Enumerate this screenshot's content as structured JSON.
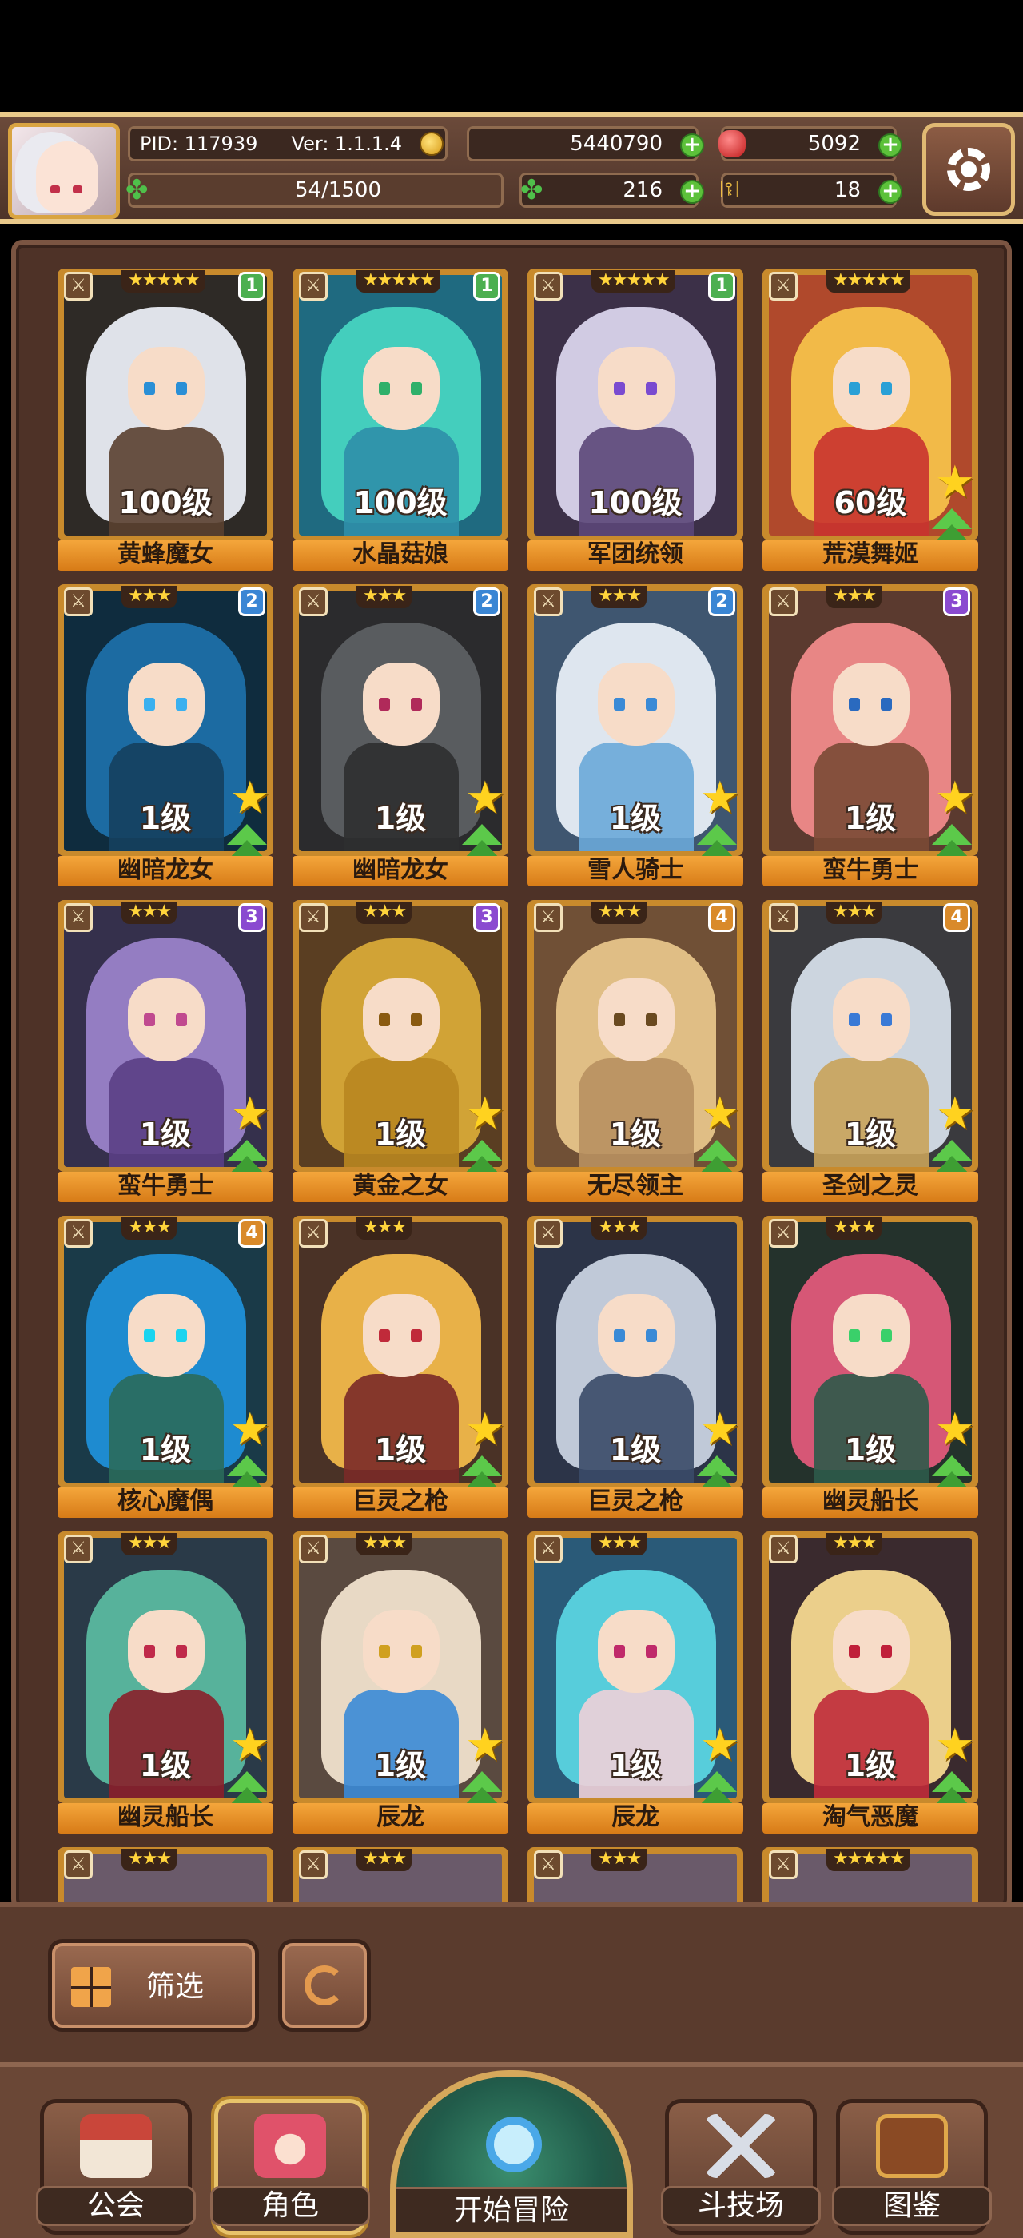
{
  "header": {
    "pid": "PID: 117939",
    "version": "Ver: 1.1.1.4",
    "gold": "5440790",
    "rubies": "5092",
    "energy": "54/1500",
    "clovers": "216",
    "keys": "18",
    "icons": {
      "gold": "coin-icon",
      "rubies": "ruby-icon",
      "energy": "clover-icon",
      "clovers": "clover-icon",
      "keys": "key-icon",
      "settings": "gear-icon"
    }
  },
  "characters": [
    {
      "name": "黄蜂魔女",
      "level": "100级",
      "stars": "★★★★★",
      "tier": "1",
      "tier_color": "#4caf50",
      "hair": "#e9ecf3",
      "body": "#5a4030",
      "bg": "#2e2a26",
      "eye": "#2a8fd6",
      "has_star": false
    },
    {
      "name": "水晶菇娘",
      "level": "100级",
      "stars": "★★★★★",
      "tier": "1",
      "tier_color": "#4caf50",
      "hair": "#47d4c0",
      "body": "#2f8fa8",
      "bg": "#1f6a80",
      "eye": "#2fb06a",
      "has_star": false
    },
    {
      "name": "军团统领",
      "level": "100级",
      "stars": "★★★★★",
      "tier": "1",
      "tier_color": "#4caf50",
      "hair": "#d9d4ec",
      "body": "#5b4778",
      "bg": "#3c3048",
      "eye": "#7a4bd0",
      "has_star": false
    },
    {
      "name": "荒漠舞姬",
      "level": "60级",
      "stars": "★★★★★",
      "tier": "",
      "tier_color": "",
      "hair": "#f6c14a",
      "body": "#c9332f",
      "bg": "#b0492c",
      "eye": "#2aa0d6",
      "has_star": true
    },
    {
      "name": "幽暗龙女",
      "level": "1级",
      "stars": "★★★",
      "tier": "2",
      "tier_color": "#3a86d4",
      "hair": "#1d6fa8",
      "body": "#15405e",
      "bg": "#0f2c3e",
      "eye": "#3ab0ef",
      "has_star": true
    },
    {
      "name": "幽暗龙女",
      "level": "1级",
      "stars": "★★★",
      "tier": "2",
      "tier_color": "#3a86d4",
      "hair": "#5c5f62",
      "body": "#2e2f30",
      "bg": "#2b2b2d",
      "eye": "#b02a5a",
      "has_star": true
    },
    {
      "name": "雪人骑士",
      "level": "1级",
      "stars": "★★★",
      "tier": "2",
      "tier_color": "#3a86d4",
      "hair": "#e7eef5",
      "body": "#6aa8d8",
      "bg": "#3f5670",
      "eye": "#3a8ad6",
      "has_star": true
    },
    {
      "name": "蛮牛勇士",
      "level": "1级",
      "stars": "★★★",
      "tier": "3",
      "tier_color": "#8a4ad0",
      "hair": "#f08a8a",
      "body": "#7a4a35",
      "bg": "#5b3a2f",
      "eye": "#2a6abf",
      "has_star": true
    },
    {
      "name": "蛮牛勇士",
      "level": "1级",
      "stars": "★★★",
      "tier": "3",
      "tier_color": "#8a4ad0",
      "hair": "#9a82c8",
      "body": "#5a3f85",
      "bg": "#35304c",
      "eye": "#c04a8f",
      "has_star": true
    },
    {
      "name": "黄金之女",
      "level": "1级",
      "stars": "★★★",
      "tier": "3",
      "tier_color": "#8a4ad0",
      "hair": "#d8a938",
      "body": "#b88620",
      "bg": "#5a3e22",
      "eye": "#8a5a10",
      "has_star": true
    },
    {
      "name": "无尽领主",
      "level": "1级",
      "stars": "★★★",
      "tier": "4",
      "tier_color": "#d98a2a",
      "hair": "#e6c48a",
      "body": "#b89060",
      "bg": "#705036",
      "eye": "#6a4a20",
      "has_star": true
    },
    {
      "name": "圣剑之灵",
      "level": "1级",
      "stars": "★★★",
      "tier": "4",
      "tier_color": "#d98a2a",
      "hair": "#d4dde8",
      "body": "#c9a35a",
      "bg": "#3a3a3e",
      "eye": "#3a7ad6",
      "has_star": true
    },
    {
      "name": "核心魔偶",
      "level": "1级",
      "stars": "★★★",
      "tier": "4",
      "tier_color": "#d98a2a",
      "hair": "#1f8fd8",
      "body": "#2a6a5a",
      "bg": "#1a3a48",
      "eye": "#1ad4ef",
      "has_star": true
    },
    {
      "name": "巨灵之枪",
      "level": "1级",
      "stars": "★★★",
      "tier": "",
      "tier_color": "",
      "hair": "#f0b84a",
      "body": "#7a2a28",
      "bg": "#4a3226",
      "eye": "#c02a3a",
      "has_star": true
    },
    {
      "name": "巨灵之枪",
      "level": "1级",
      "stars": "★★★",
      "tier": "",
      "tier_color": "",
      "hair": "#c8d2e0",
      "body": "#3a4a68",
      "bg": "#2c3448",
      "eye": "#3a8ad6",
      "has_star": true
    },
    {
      "name": "幽灵船长",
      "level": "1级",
      "stars": "★★★",
      "tier": "",
      "tier_color": "",
      "hair": "#e05a7a",
      "body": "#2e5a4a",
      "bg": "#24322c",
      "eye": "#3ad06a",
      "has_star": true
    },
    {
      "name": "幽灵船长",
      "level": "1级",
      "stars": "★★★",
      "tier": "",
      "tier_color": "",
      "hair": "#5ab8a0",
      "body": "#8a1f2a",
      "bg": "#2a3a48",
      "eye": "#c02a4a",
      "has_star": true
    },
    {
      "name": "辰龙",
      "level": "1级",
      "stars": "★★★",
      "tier": "",
      "tier_color": "",
      "hair": "#f0e0cc",
      "body": "#3a8ad6",
      "bg": "#5a4a40",
      "eye": "#d0a020",
      "has_star": true
    },
    {
      "name": "辰龙",
      "level": "1级",
      "stars": "★★★",
      "tier": "",
      "tier_color": "",
      "hair": "#5ad4e0",
      "body": "#f0d0d8",
      "bg": "#2a5a78",
      "eye": "#c02a6a",
      "has_star": true
    },
    {
      "name": "淘气恶魔",
      "level": "1级",
      "stars": "★★★",
      "tier": "",
      "tier_color": "",
      "hair": "#f4d890",
      "body": "#c02a3a",
      "bg": "#3a2a2e",
      "eye": "#c0203a",
      "has_star": true
    }
  ],
  "partial_row_stars": [
    "★★★",
    "★★★",
    "★★★",
    "★★★★★"
  ],
  "controls": {
    "filter_label": "筛选"
  },
  "nav": {
    "guild": "公会",
    "characters": "角色",
    "adventure": "开始冒险",
    "arena": "斗技场",
    "codex": "图鉴"
  }
}
